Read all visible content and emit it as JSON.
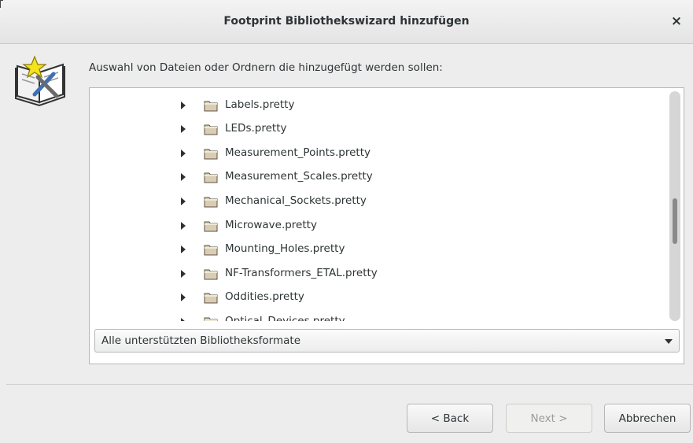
{
  "window": {
    "title": "Footprint Bibliothekswizard hinzufügen",
    "close_glyph": "×"
  },
  "prompt": "Auswahl von Dateien oder Ordnern die hinzugefügt werden sollen:",
  "tree": {
    "rows": [
      {
        "label": "Labels.pretty"
      },
      {
        "label": "LEDs.pretty"
      },
      {
        "label": "Measurement_Points.pretty"
      },
      {
        "label": "Measurement_Scales.pretty"
      },
      {
        "label": "Mechanical_Sockets.pretty"
      },
      {
        "label": "Microwave.pretty"
      },
      {
        "label": "Mounting_Holes.pretty"
      },
      {
        "label": "NF-Transformers_ETAL.pretty"
      },
      {
        "label": "Oddities.pretty"
      },
      {
        "label": "Optical_Devices.pretty"
      }
    ]
  },
  "filter": {
    "selected": "Alle unterstützten Bibliotheksformate"
  },
  "buttons": {
    "back": "< Back",
    "next": "Next >",
    "cancel": "Abbrechen"
  },
  "icons": {
    "wizard": "book-wizard-icon",
    "folder": "folder-icon",
    "expander": "triangle-right-icon",
    "dropdown": "triangle-down-icon"
  },
  "colors": {
    "background": "#ededed",
    "panel": "#ffffff",
    "folder": "#d9cdb4",
    "text": "#2e3436"
  }
}
